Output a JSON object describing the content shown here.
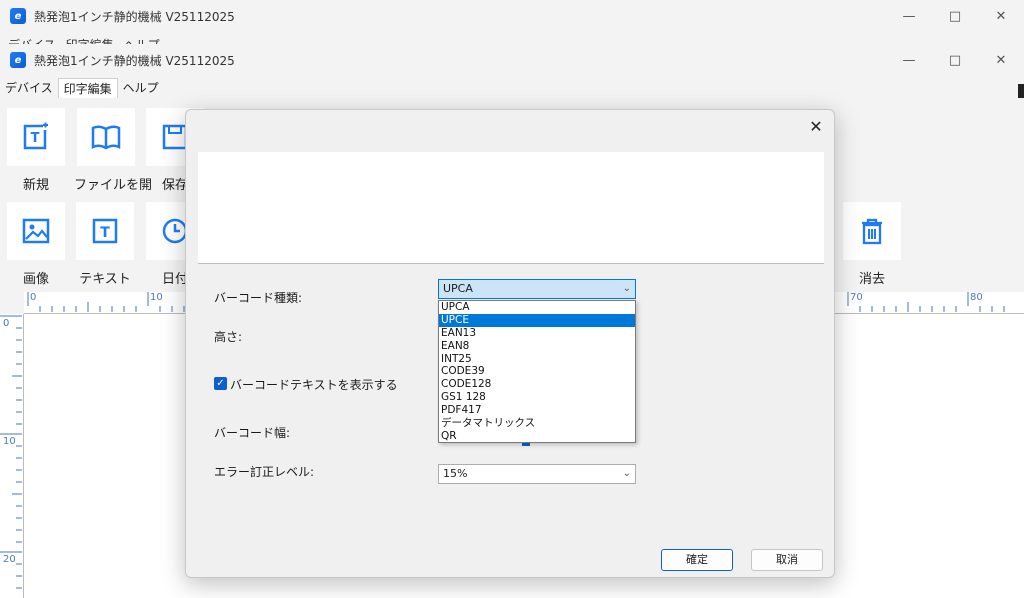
{
  "bg_window": {
    "title": "熱発泡1インチ静的機械 V25112025",
    "menu": [
      "デバイス",
      "印字編集",
      "ヘルプ"
    ]
  },
  "main_window": {
    "title": "熱発泡1インチ静的機械 V25112025",
    "menu": [
      "デバイス",
      "印字編集",
      "ヘルプ"
    ],
    "tools_row1": [
      "新規",
      "ファイルを開",
      "保存"
    ],
    "tools_row2": [
      "画像",
      "テキスト",
      "日付"
    ],
    "tool_delete": "消去",
    "ruler_h": [
      "0",
      "10",
      "70",
      "80"
    ],
    "ruler_v": [
      "0",
      "10",
      "20"
    ]
  },
  "dialog": {
    "labels": {
      "barcode_type": "バーコード種類:",
      "height": "高さ:",
      "show_text": "バーコードテキストを表示する",
      "barcode_width": "バーコード幅:",
      "error_level": "エラー訂正レベル:"
    },
    "barcode_type_value": "UPCA",
    "barcode_options": [
      "UPCA",
      "UPCE",
      "EAN13",
      "EAN8",
      "INT25",
      "CODE39",
      "CODE128",
      "GS1 128",
      "PDF417",
      "データマトリックス",
      "QR"
    ],
    "highlighted_option": "UPCE",
    "show_text_checked": true,
    "error_level_value": "15%",
    "ok_label": "確定",
    "cancel_label": "取消"
  },
  "colors": {
    "accent": "#0078d7",
    "icon_blue": "#1f7bf5"
  }
}
